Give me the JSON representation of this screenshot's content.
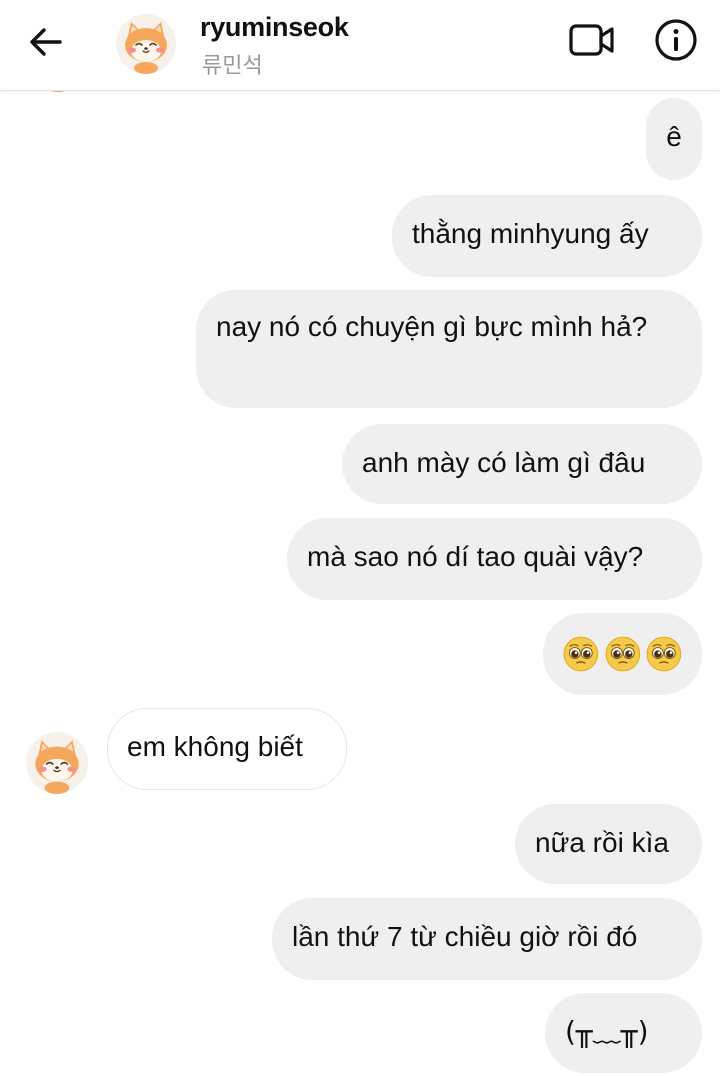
{
  "header": {
    "username": "ryuminseok",
    "subname": "류민석"
  },
  "messages": [
    {
      "from": "me",
      "text": "ê"
    },
    {
      "from": "me",
      "text": "thằng minhyung ấy"
    },
    {
      "from": "me",
      "text": "nay nó có chuyện gì bực mình hả?"
    },
    {
      "from": "me",
      "text": "anh mày có làm gì đâu"
    },
    {
      "from": "me",
      "text": "mà sao nó dí tao quài vậy?"
    },
    {
      "from": "me",
      "emoji": [
        "pleading-face",
        "pleading-face",
        "pleading-face"
      ]
    },
    {
      "from": "them",
      "text": "em không biết"
    },
    {
      "from": "me",
      "text": "nữa rồi kìa"
    },
    {
      "from": "me",
      "text": "lần thứ 7 từ chiều giờ rồi đó"
    },
    {
      "from": "me",
      "text": "(╥﹏╥)"
    }
  ],
  "icons": {
    "back": "arrow-left-icon",
    "video": "video-camera-icon",
    "info": "info-icon",
    "emoji": "pleading-face-emoji"
  },
  "colors": {
    "bubble_outgoing": "#efefef",
    "bubble_incoming_border": "#e6e6e6",
    "text": "#111111",
    "subtext": "#9a9a9a"
  }
}
